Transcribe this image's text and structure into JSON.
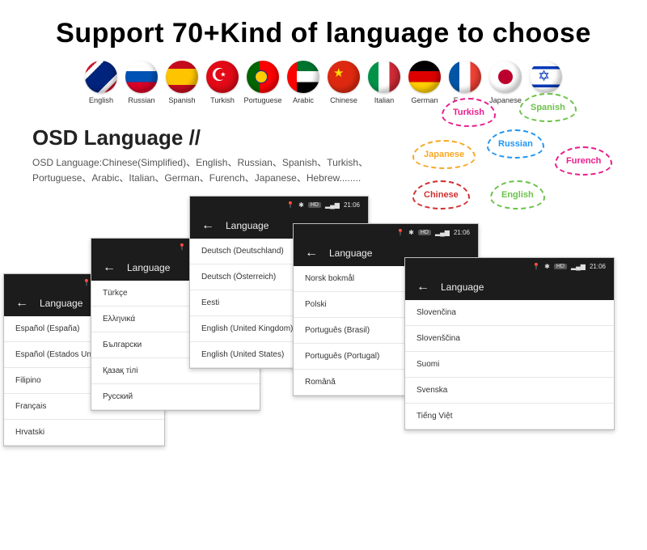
{
  "headline": "Support 70+Kind of language to choose",
  "flag_labels": [
    "English",
    "Russian",
    "Spanish",
    "Turkish",
    "Portuguese",
    "Arabic",
    "Chinese",
    "Italian",
    "German",
    "French",
    "Japanese",
    "Hebrew"
  ],
  "osd": {
    "title": "OSD Language //",
    "desc": "OSD Language:Chinese(Simplified)、English、Russian、Spanish、Turkish、Portuguese、Arabic、Italian、German、Furench、Japanese、Hebrew........"
  },
  "bubbles": [
    "Turkish",
    "Spanish",
    "Japanese",
    "Russian",
    "Furench",
    "Chinese",
    "English"
  ],
  "status": {
    "hd": "HD",
    "bars": "▂▄▆",
    "time": "21:06"
  },
  "window_title": "Language",
  "back_arrow": "←",
  "pin": "📍",
  "bt": "✱",
  "devices": [
    {
      "items": [
        "Español (España)",
        "Español (Estados Unidos)",
        "Filipino",
        "Français",
        "Hrvatski"
      ]
    },
    {
      "items": [
        "Türkçe",
        "Ελληνικά",
        "Български",
        "Қазақ тілі",
        "Русский"
      ]
    },
    {
      "items": [
        "Deutsch (Deutschland)",
        "Deutsch (Österreich)",
        "Eesti",
        "English (United Kingdom)",
        "English (United States)"
      ]
    },
    {
      "items": [
        "Norsk bokmål",
        "Polski",
        "Português (Brasil)",
        "Português (Portugal)",
        "Română"
      ]
    },
    {
      "items": [
        "Slovenčina",
        "Slovenščina",
        "Suomi",
        "Svenska",
        "Tiếng Việt"
      ]
    }
  ]
}
